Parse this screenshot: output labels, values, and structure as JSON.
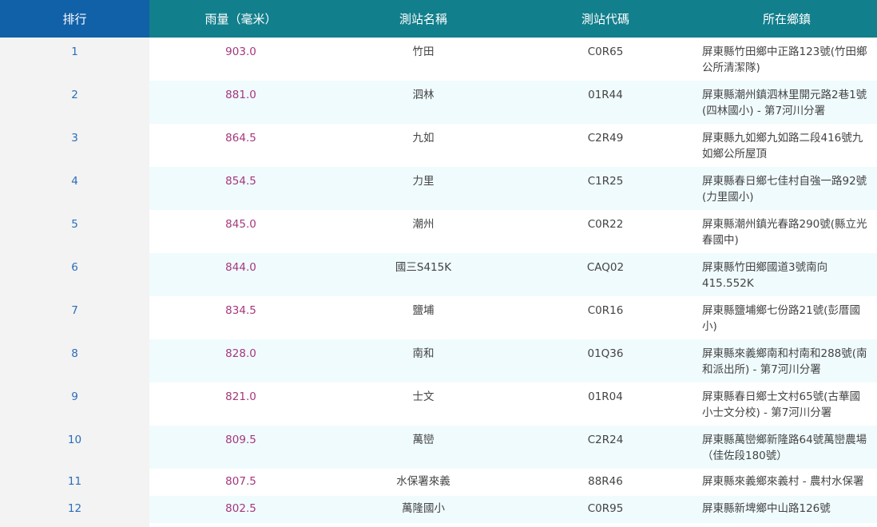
{
  "table": {
    "headers": {
      "rank": "排行",
      "rainfall": "雨量（毫米）",
      "station_name": "測站名稱",
      "station_code": "測站代碼",
      "township": "所在鄉鎮"
    },
    "rows": [
      {
        "rank": "1",
        "rainfall": "903.0",
        "station_name": "竹田",
        "station_code": "C0R65",
        "township": "屏東縣竹田鄉中正路123號(竹田鄉公所清潔隊)"
      },
      {
        "rank": "2",
        "rainfall": "881.0",
        "station_name": "泗林",
        "station_code": "01R44",
        "township": "屏東縣潮州鎮泗林里開元路2巷1號(四林國小) - 第7河川分署"
      },
      {
        "rank": "3",
        "rainfall": "864.5",
        "station_name": "九如",
        "station_code": "C2R49",
        "township": "屏東縣九如鄉九如路二段416號九如鄉公所屋頂"
      },
      {
        "rank": "4",
        "rainfall": "854.5",
        "station_name": "力里",
        "station_code": "C1R25",
        "township": "屏東縣春日鄉七佳村自強一路92號(力里國小)"
      },
      {
        "rank": "5",
        "rainfall": "845.0",
        "station_name": "潮州",
        "station_code": "C0R22",
        "township": "屏東縣潮州鎮光春路290號(縣立光春國中)"
      },
      {
        "rank": "6",
        "rainfall": "844.0",
        "station_name": "國三S415K",
        "station_code": "CAQ02",
        "township": "屏東縣竹田鄉國道3號南向415.552K"
      },
      {
        "rank": "7",
        "rainfall": "834.5",
        "station_name": "鹽埔",
        "station_code": "C0R16",
        "township": "屏東縣鹽埔鄉七份路21號(彭厝國小)"
      },
      {
        "rank": "8",
        "rainfall": "828.0",
        "station_name": "南和",
        "station_code": "01Q36",
        "township": "屏東縣來義鄉南和村南和288號(南和派出所) - 第7河川分署"
      },
      {
        "rank": "9",
        "rainfall": "821.0",
        "station_name": "士文",
        "station_code": "01R04",
        "township": "屏東縣春日鄉士文村65號(古華國小士文分校) - 第7河川分署"
      },
      {
        "rank": "10",
        "rainfall": "809.5",
        "station_name": "萬巒",
        "station_code": "C2R24",
        "township": "屏東縣萬巒鄉新隆路64號萬巒農場（佳佐段180號）"
      },
      {
        "rank": "11",
        "rainfall": "807.5",
        "station_name": "水保署來義",
        "station_code": "88R46",
        "township": "屏東縣來義鄉來義村 - 農村水保署"
      },
      {
        "rank": "12",
        "rainfall": "802.5",
        "station_name": "萬隆國小",
        "station_code": "C0R95",
        "township": "屏東縣新埤鄉中山路126號"
      }
    ]
  },
  "colors": {
    "header_rank_bg": "#1161a9",
    "header_bg": "#127f8c",
    "rank_text": "#2a6db8",
    "rainfall_text": "#a6367c",
    "row_alt_bg": "#f0fbfd",
    "rank_col_bg": "#f3f3f3"
  }
}
